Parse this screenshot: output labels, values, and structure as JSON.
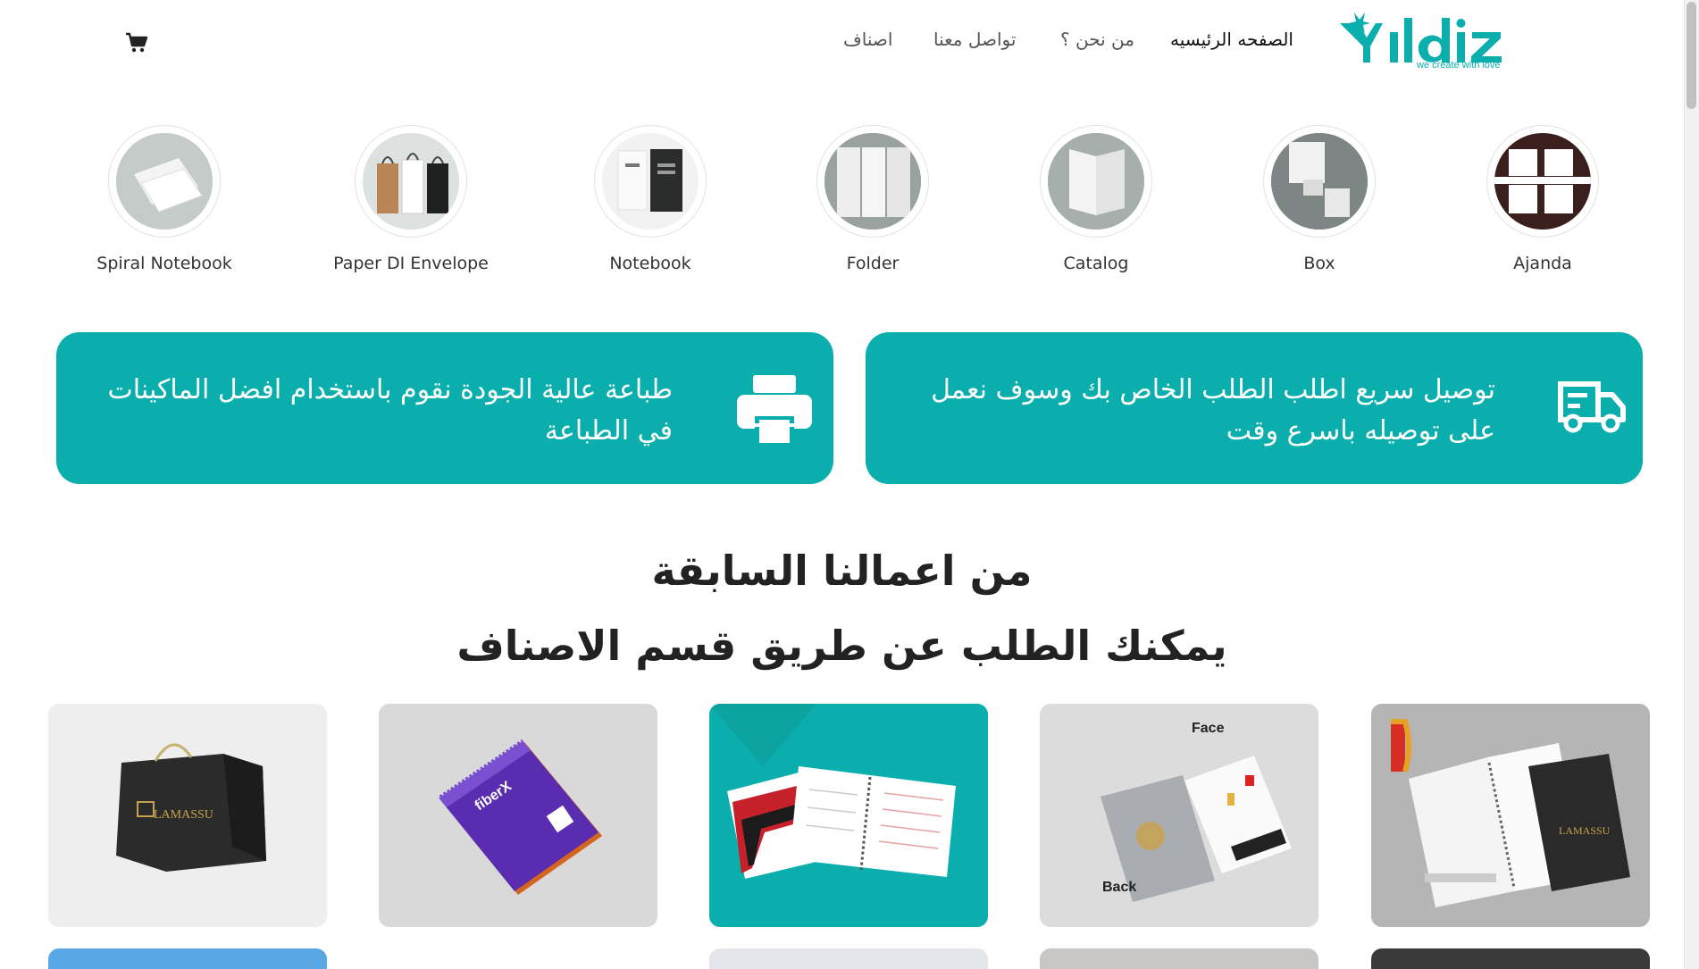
{
  "brand": {
    "name": "Yildiz",
    "tagline": "we create with love",
    "accent_color": "#0aaead"
  },
  "nav": {
    "home": "الصفحه الرئيسيه",
    "about": "من نحن ؟",
    "contact": "تواصل معنا",
    "categories": "اصناف",
    "cart_icon": "cart-icon"
  },
  "categories": [
    {
      "label": "Ajanda",
      "icon": "ajanda-image"
    },
    {
      "label": "Box",
      "icon": "box-image"
    },
    {
      "label": "Catalog",
      "icon": "catalog-image"
    },
    {
      "label": "Folder",
      "icon": "folder-image"
    },
    {
      "label": "Notebook",
      "icon": "notebook-image"
    },
    {
      "label": "Paper DI Envelope",
      "icon": "paper-bag-image"
    },
    {
      "label": "Spiral Notebook",
      "icon": "envelope-image"
    }
  ],
  "features": {
    "delivery": {
      "text": "توصيل سريع اطلب الطلب الخاص بك وسوف نعمل على توصيله باسرع وقت",
      "icon": "truck-icon"
    },
    "printing": {
      "text": "طباعة عالية الجودة نقوم باستخدام افضل الماكينات في الطباعة",
      "icon": "printer-icon"
    }
  },
  "works": {
    "title": "من اعمالنا السابقة",
    "subtitle": "يمكنك الطلب عن طريق قسم الاصناف",
    "face_label": "Face",
    "back_label": "Back",
    "lamassu": "LAMASSU",
    "fiberx": "fiberX"
  }
}
